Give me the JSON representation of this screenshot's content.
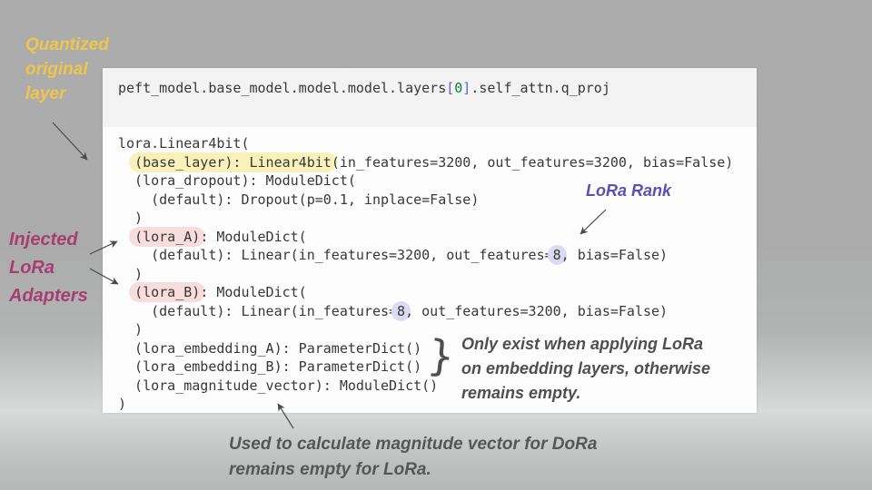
{
  "slide": {
    "background_colors": {
      "top": "#ababab",
      "light_band": "#d8dada",
      "bottom": "#b6b8b8"
    }
  },
  "code_panel": {
    "header": {
      "segments": [
        {
          "t": "peft_model.base_model.model.model.layers"
        },
        {
          "t": "[",
          "c": "bracket"
        },
        {
          "t": "0",
          "c": "number"
        },
        {
          "t": "]",
          "c": "bracket"
        },
        {
          "t": ".self_attn.q_proj"
        }
      ]
    },
    "body_lines": [
      {
        "segments": [
          {
            "t": "lora.Linear4bit("
          }
        ]
      },
      {
        "segments": [
          {
            "t": "  "
          },
          {
            "t": "(base_layer): Linear4bit",
            "hl": "yellow"
          },
          {
            "t": "(in_features=3200, out_features=3200, bias=False)"
          }
        ]
      },
      {
        "segments": [
          {
            "t": "  (lora_dropout): ModuleDict("
          }
        ]
      },
      {
        "segments": [
          {
            "t": "    (default): Dropout(p=0.1, inplace=False)"
          }
        ]
      },
      {
        "segments": [
          {
            "t": "  )"
          }
        ]
      },
      {
        "segments": [
          {
            "t": "  "
          },
          {
            "t": "(lora_A)",
            "hl": "pink"
          },
          {
            "t": ": ModuleDict("
          }
        ]
      },
      {
        "segments": [
          {
            "t": "    (default): Linear(in_features=3200, out_features="
          },
          {
            "t": "8",
            "hl": "purple"
          },
          {
            "t": ", bias=False)"
          }
        ]
      },
      {
        "segments": [
          {
            "t": "  )"
          }
        ]
      },
      {
        "segments": [
          {
            "t": "  "
          },
          {
            "t": "(lora_B)",
            "hl": "pink"
          },
          {
            "t": ": ModuleDict("
          }
        ]
      },
      {
        "segments": [
          {
            "t": "    (default): Linear(in_features="
          },
          {
            "t": "8",
            "hl": "purple"
          },
          {
            "t": ", out_features=3200, bias=False)"
          }
        ]
      },
      {
        "segments": [
          {
            "t": "  )"
          }
        ]
      },
      {
        "segments": [
          {
            "t": "  (lora_embedding_A): ParameterDict()"
          }
        ]
      },
      {
        "segments": [
          {
            "t": "  (lora_embedding_B): ParameterDict()"
          }
        ]
      },
      {
        "segments": [
          {
            "t": "  (lora_magnitude_vector): ModuleDict()"
          }
        ]
      },
      {
        "segments": [
          {
            "t": ")"
          }
        ]
      }
    ]
  },
  "annotations": {
    "quantized": {
      "lines": [
        "Quantized",
        "original",
        "layer"
      ],
      "color": "#f0c64a"
    },
    "injected": {
      "lines": [
        "Injected",
        "LoRa",
        "Adapters"
      ],
      "color": "#a63e71"
    },
    "lora_rank": {
      "text": "LoRa Rank",
      "color": "#5a50b5"
    },
    "embedding_note": {
      "lines": [
        "Only exist when applying LoRa",
        "on embedding layers, otherwise",
        "remains empty."
      ],
      "color": "#4f4f4f"
    },
    "magnitude_note": {
      "lines": [
        "Used to calculate magnitude vector for DoRa",
        "remains empty for LoRa."
      ],
      "color": "#565656"
    },
    "brace_glyph": "}"
  },
  "highlight_colors": {
    "yellow": "#f9f1ba",
    "pink": "#f9dcdc",
    "purple": "#dcdaf2"
  }
}
